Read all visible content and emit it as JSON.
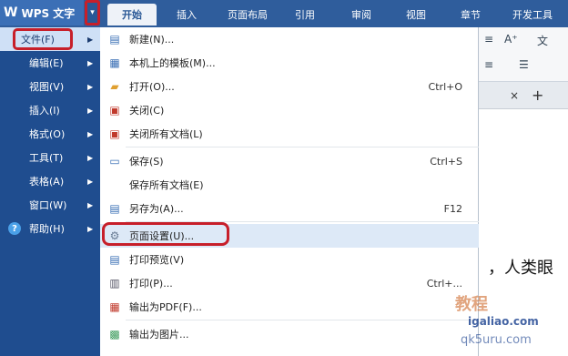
{
  "app": {
    "logo": "W",
    "title": "WPS 文字",
    "menu_button_icon": "▾"
  },
  "ribbon_tabs": [
    {
      "label": "开始",
      "active": true
    },
    {
      "label": "插入"
    },
    {
      "label": "页面布局"
    },
    {
      "label": "引用"
    },
    {
      "label": "审阅"
    },
    {
      "label": "视图"
    },
    {
      "label": "章节"
    },
    {
      "label": "开发工具"
    }
  ],
  "ribbon_controls": {
    "font_grow": "A⁺",
    "pinyin": "文",
    "align": "≡",
    "line_spacing": "☰"
  },
  "doc_tab": {
    "close": "×",
    "add": "+"
  },
  "document": {
    "visible_text": "，人类眼"
  },
  "left_menu": {
    "items": [
      {
        "label": "文件(F)",
        "selected": true
      },
      {
        "label": "编辑(E)"
      },
      {
        "label": "视图(V)"
      },
      {
        "label": "插入(I)"
      },
      {
        "label": "格式(O)"
      },
      {
        "label": "工具(T)"
      },
      {
        "label": "表格(A)"
      },
      {
        "label": "窗口(W)"
      },
      {
        "label": "帮助(H)",
        "icon": "help-icon",
        "icon_glyph": "?"
      }
    ],
    "arrow": "▶"
  },
  "file_menu": {
    "items": [
      {
        "label": "新建(N)...",
        "shortcut": "",
        "icon": "new-doc-icon",
        "glyph": "▤"
      },
      {
        "label": "本机上的模板(M)...",
        "shortcut": "",
        "icon": "template-icon",
        "glyph": "▦"
      },
      {
        "label": "打开(O)...",
        "shortcut": "Ctrl+O",
        "icon": "open-folder-icon",
        "glyph": "▰"
      },
      {
        "label": "关闭(C)",
        "shortcut": "",
        "icon": "close-doc-icon",
        "glyph": "▣"
      },
      {
        "label": "关闭所有文档(L)",
        "shortcut": "",
        "icon": "close-all-icon",
        "glyph": "▣"
      },
      {
        "label": "保存(S)",
        "shortcut": "Ctrl+S",
        "icon": "save-icon",
        "glyph": "▭"
      },
      {
        "label": "保存所有文档(E)",
        "shortcut": "",
        "icon": "",
        "glyph": ""
      },
      {
        "label": "另存为(A)...",
        "shortcut": "F12",
        "icon": "save-as-icon",
        "glyph": "▤"
      },
      {
        "label": "页面设置(U)...",
        "shortcut": "",
        "icon": "page-setup-icon",
        "glyph": "⚙",
        "hover": true
      },
      {
        "label": "打印预览(V)",
        "shortcut": "",
        "icon": "print-preview-icon",
        "glyph": "▤"
      },
      {
        "label": "打印(P)...",
        "shortcut": "Ctrl+...",
        "icon": "print-icon",
        "glyph": "▥"
      },
      {
        "label": "输出为PDF(F)...",
        "shortcut": "",
        "icon": "pdf-icon",
        "glyph": "▦"
      },
      {
        "label": "输出为图片...",
        "shortcut": "",
        "icon": "image-export-icon",
        "glyph": "▩"
      }
    ]
  },
  "watermark": {
    "top": "教程",
    "main": "igaliao.com",
    "bottom": "qk5uru.com"
  },
  "colors": {
    "titlebar": "#2f5d9c",
    "left_menu": "#1f4d8f",
    "highlight_red": "#c71f2a",
    "hover": "#dde9f7"
  }
}
